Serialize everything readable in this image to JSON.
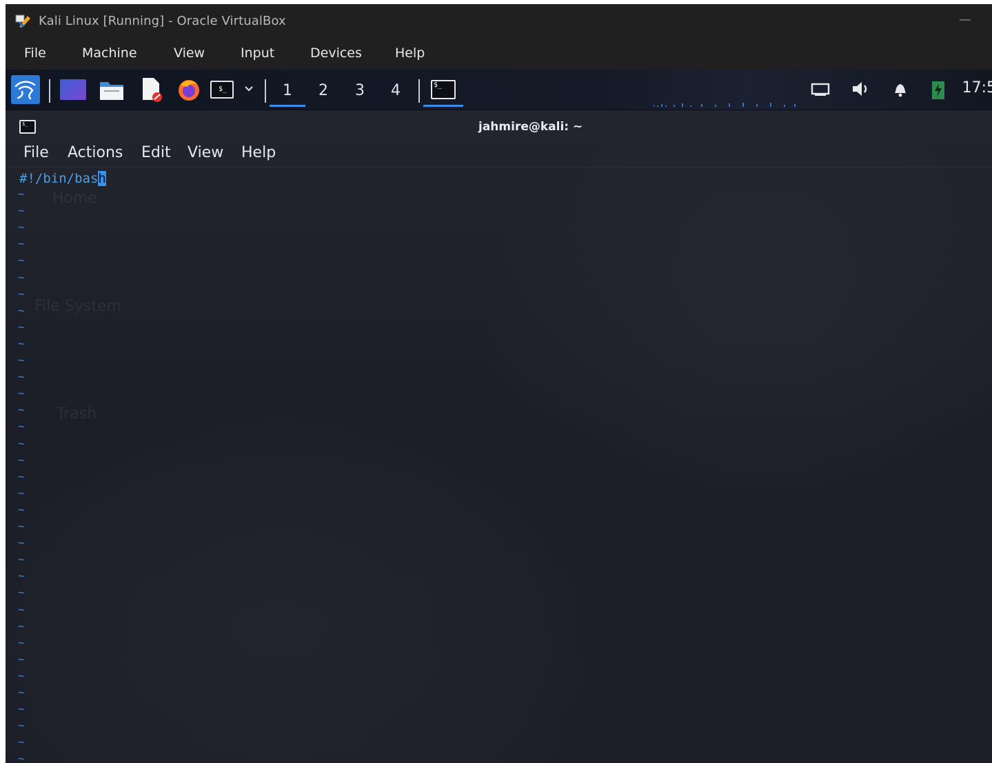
{
  "vbox": {
    "title": "Kali Linux  [Running] - Oracle VirtualBox",
    "minimize": "—",
    "menu": [
      "File",
      "Machine",
      "View",
      "Input",
      "Devices",
      "Help"
    ]
  },
  "panel": {
    "workspaces": [
      "1",
      "2",
      "3",
      "4"
    ],
    "active_workspace": "1",
    "terminal_glyph": "$_",
    "clock": "17:5"
  },
  "terminal": {
    "title": "jahmire@kali: ~",
    "menu": [
      "File",
      "Actions",
      "Edit",
      "View",
      "Help"
    ],
    "line1_text": "#!/bin/bas",
    "cursor_char": "h",
    "tilde": "~"
  },
  "desktop_ghosts": [
    "Home",
    "File System",
    "Trash"
  ],
  "colors": {
    "accent": "#3f8ce9",
    "code_text": "#4d9fe0",
    "tilde": "#3b84d4"
  }
}
